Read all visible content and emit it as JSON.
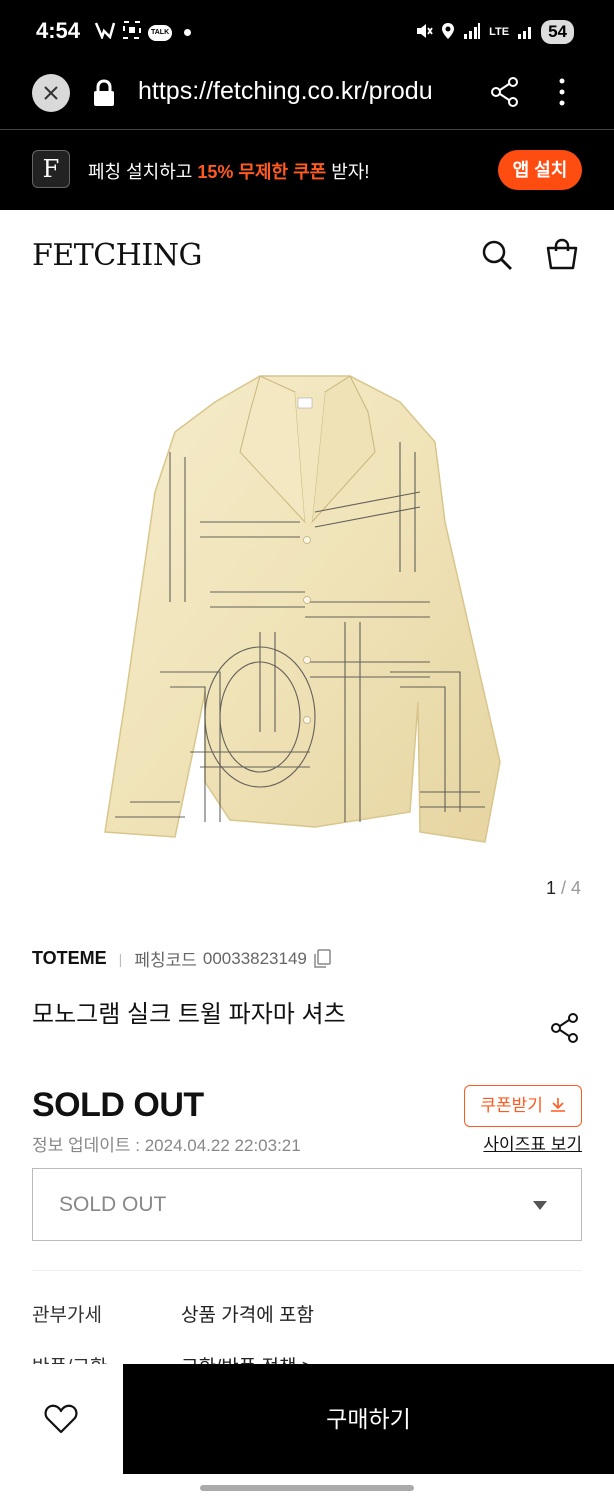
{
  "status_bar": {
    "time": "4:54",
    "talk_label": "TALK",
    "network_label": "LTE",
    "battery": "54"
  },
  "browser": {
    "url": "https://fetching.co.kr/produ"
  },
  "app_banner": {
    "logo_letter": "F",
    "text_before": "페칭 설치하고 ",
    "text_highlight": "15% 무제한 쿠폰",
    "text_after": " 받자!",
    "install_label": "앱 설치",
    "accent_color": "#ff4d12"
  },
  "site": {
    "logo": "FETCHING"
  },
  "gallery": {
    "current": "1",
    "separator": " / ",
    "total": "4"
  },
  "product": {
    "brand": "TOTEME",
    "code_label": "페칭코드",
    "code_value": "00033823149",
    "name": "모노그램 실크 트윌 파자마 셔츠",
    "status": "SOLD OUT",
    "coupon_label": "쿠폰받기",
    "update_info": "정보 업데이트 : 2024.04.22 22:03:21",
    "size_chart_label": "사이즈표 보기",
    "option_value": "SOLD OUT"
  },
  "info_rows": [
    {
      "label": "관부가세",
      "value": "상품 가격에 포함"
    },
    {
      "label": "반품/교환",
      "value": "교환/반품 정책 >"
    }
  ],
  "bottom_bar": {
    "buy_label": "구매하기"
  }
}
